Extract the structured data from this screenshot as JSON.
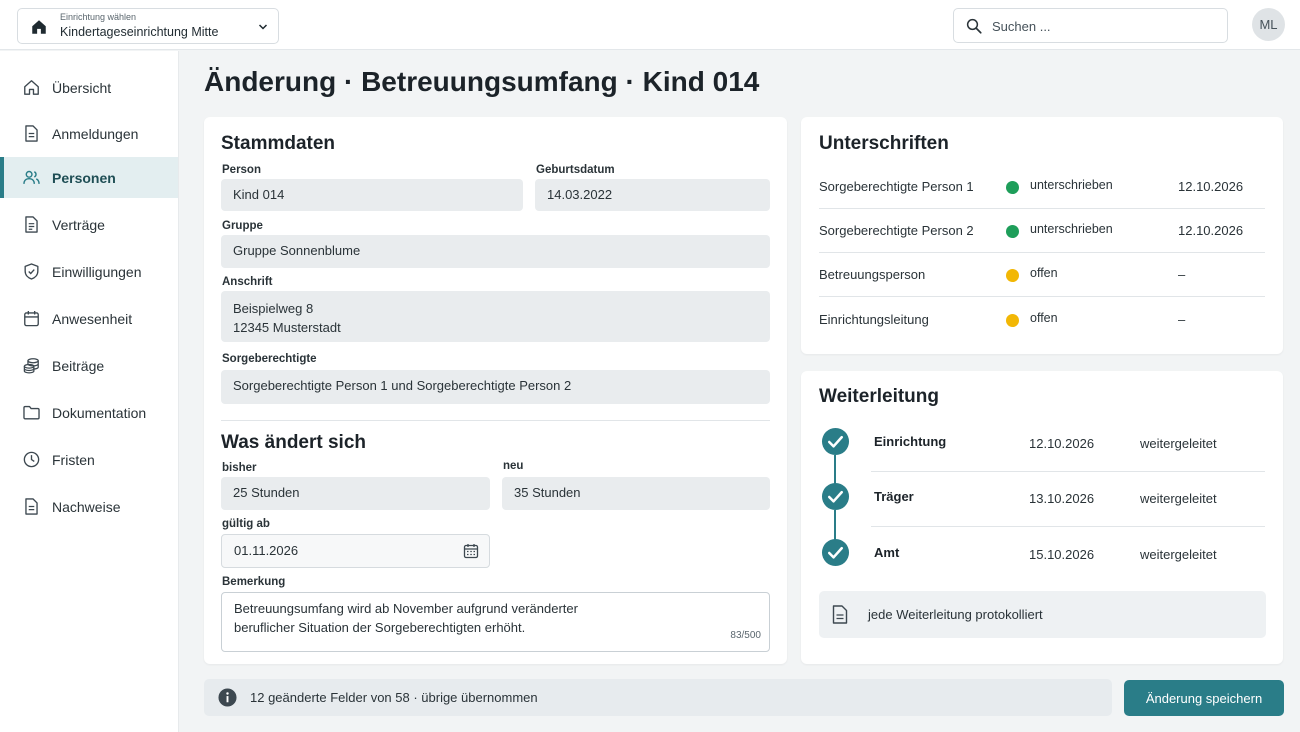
{
  "topbar": {
    "facility_label": "Einrichtung wählen",
    "facility_value": "Kindertageseinrichtung Mitte",
    "search_placeholder": "Suchen ...",
    "avatar_initials": "ML"
  },
  "sidebar": {
    "items": [
      {
        "label": "Übersicht",
        "icon": "home-icon"
      },
      {
        "label": "Anmeldungen",
        "icon": "document-icon"
      },
      {
        "label": "Personen",
        "icon": "people-icon",
        "active": true
      },
      {
        "label": "Verträge",
        "icon": "contract-icon"
      },
      {
        "label": "Einwilligungen",
        "icon": "shield-check-icon"
      },
      {
        "label": "Anwesenheit",
        "icon": "calendar-icon"
      },
      {
        "label": "Beiträge",
        "icon": "coins-icon"
      },
      {
        "label": "Dokumentation",
        "icon": "folder-icon"
      },
      {
        "label": "Fristen",
        "icon": "clock-icon"
      },
      {
        "label": "Nachweise",
        "icon": "document-icon"
      }
    ]
  },
  "page": {
    "title": "Änderung · Betreuungsumfang · Kind 014"
  },
  "stammdaten": {
    "heading": "Stammdaten",
    "person_label": "Person",
    "person_value": "Kind 014",
    "birth_label": "Geburtsdatum",
    "birth_value": "14.03.2022",
    "group_label": "Gruppe",
    "group_value": "Gruppe Sonnenblume",
    "address_label": "Anschrift",
    "address_line1": "Beispielweg 8",
    "address_line2": "12345 Musterstadt",
    "guardians_label": "Sorgeberechtigte",
    "guardians_value": "Sorgeberechtigte Person  1 und Sorgeberechtigte Person 2"
  },
  "change": {
    "heading": "Was ändert sich",
    "before_label": "bisher",
    "before_value": "25 Stunden",
    "after_label": "neu",
    "after_value": "35 Stunden",
    "valid_label": "gültig ab",
    "valid_value": "01.11.2026",
    "remark_label": "Bemerkung",
    "remark_value": "Betreuungsumfang wird ab November aufgrund veränderter beruflicher Situation der Sorgeberechtigten erhöht.",
    "remark_counter": "83/500"
  },
  "signatures": {
    "heading": "Unterschriften",
    "rows": [
      {
        "who": "Sorgeberechtigte Person 1",
        "status": "unterschrieben",
        "date": "12.10.2026",
        "color": "#1e9e5a"
      },
      {
        "who": "Sorgeberechtigte Person 2",
        "status": "unterschrieben",
        "date": "12.10.2026",
        "color": "#1e9e5a"
      },
      {
        "who": "Betreuungsperson",
        "status": "offen",
        "date": "–",
        "color": "#f2b705"
      },
      {
        "who": "Einrichtungsleitung",
        "status": "offen",
        "date": "–",
        "color": "#f2b705"
      }
    ]
  },
  "forwarding": {
    "heading": "Weiterleitung",
    "rows": [
      {
        "name": "Einrichtung",
        "date": "12.10.2026",
        "status": "weitergeleitet"
      },
      {
        "name": "Träger",
        "date": "13.10.2026",
        "status": "weitergeleitet"
      },
      {
        "name": "Amt",
        "date": "15.10.2026",
        "status": "weitergeleitet"
      }
    ],
    "note": "jede Weiterleitung protokolliert"
  },
  "footer": {
    "info": "12 geänderte Felder von 58 · übrige übernommen",
    "save_label": "Änderung speichern"
  },
  "colors": {
    "accent": "#2a7d88",
    "signed": "#1e9e5a",
    "open": "#f2b705"
  }
}
